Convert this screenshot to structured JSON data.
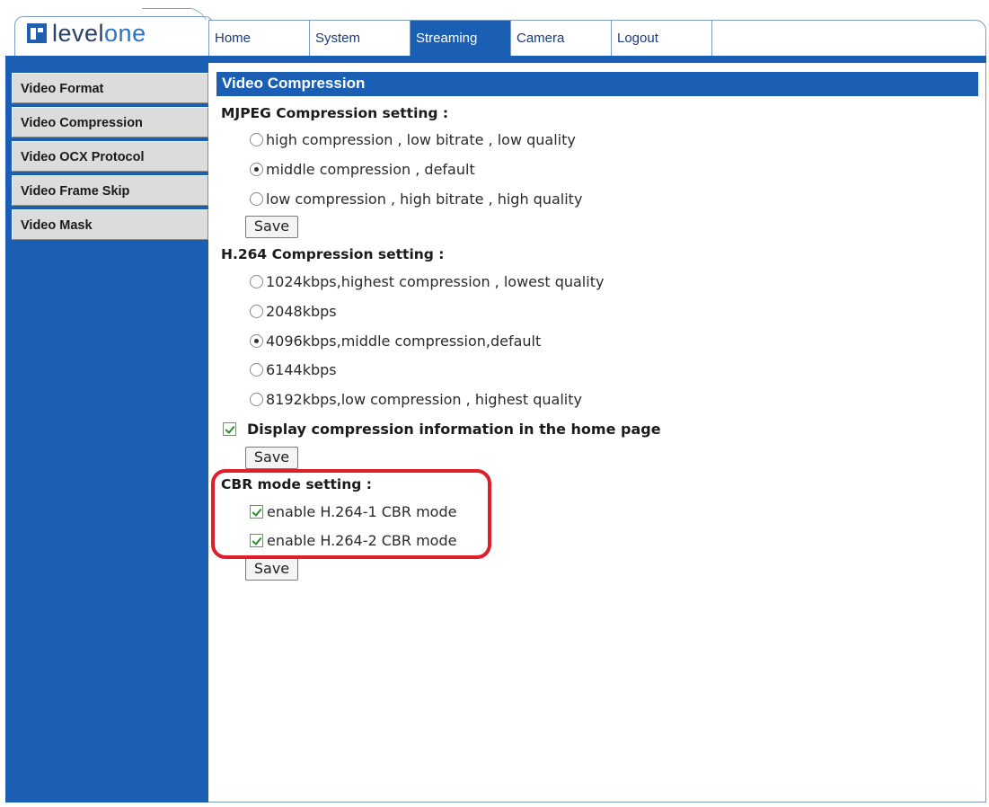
{
  "brand": {
    "name_a": "level",
    "name_b": "one"
  },
  "nav": {
    "tabs": [
      {
        "label": "Home"
      },
      {
        "label": "System"
      },
      {
        "label": "Streaming"
      },
      {
        "label": "Camera"
      },
      {
        "label": "Logout"
      }
    ],
    "active": "Streaming"
  },
  "sidebar": {
    "items": [
      {
        "label": "Video Format"
      },
      {
        "label": "Video Compression"
      },
      {
        "label": "Video OCX Protocol"
      },
      {
        "label": "Video Frame Skip"
      },
      {
        "label": "Video Mask"
      }
    ]
  },
  "main": {
    "title": "Video Compression",
    "mjpeg": {
      "heading": "MJPEG Compression setting :",
      "options": [
        {
          "label": "high compression , low bitrate , low quality",
          "checked": false
        },
        {
          "label": "middle compression , default",
          "checked": true
        },
        {
          "label": "low compression , high bitrate , high quality",
          "checked": false
        }
      ],
      "save_label": "Save"
    },
    "h264": {
      "heading": "H.264 Compression setting :",
      "options": [
        {
          "label": "1024kbps,highest compression , lowest quality",
          "checked": false
        },
        {
          "label": "2048kbps",
          "checked": false
        },
        {
          "label": "4096kbps,middle compression,default",
          "checked": true
        },
        {
          "label": "6144kbps",
          "checked": false
        },
        {
          "label": "8192kbps,low compression , highest quality",
          "checked": false
        }
      ],
      "display_info": {
        "label": "Display compression information in the home page",
        "checked": true
      },
      "save_label": "Save"
    },
    "cbr": {
      "heading": "CBR mode setting :",
      "options": [
        {
          "label": "enable H.264-1 CBR mode",
          "checked": true
        },
        {
          "label": "enable H.264-2 CBR mode",
          "checked": true
        }
      ],
      "save_label": "Save"
    }
  },
  "colors": {
    "brand_blue": "#1a5fb4",
    "highlight_red": "#e01d28",
    "sidebar_item_bg": "#dcdcdc"
  }
}
